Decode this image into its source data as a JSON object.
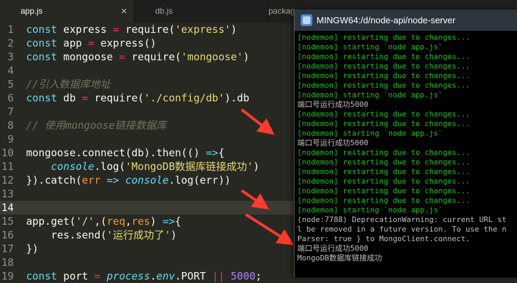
{
  "editor": {
    "tabs": [
      {
        "label": "app.js",
        "close_icon": "×"
      },
      {
        "label": "db.js"
      },
      {
        "label": "package"
      }
    ],
    "lines": [
      {
        "n": "1",
        "tokens": [
          [
            "kw",
            "const"
          ],
          [
            "t",
            " express "
          ],
          [
            "op",
            "="
          ],
          [
            "t",
            " require("
          ],
          [
            "str",
            "'express'"
          ],
          [
            "t",
            ")"
          ]
        ]
      },
      {
        "n": "2",
        "tokens": [
          [
            "kw",
            "const"
          ],
          [
            "t",
            " app "
          ],
          [
            "op",
            "="
          ],
          [
            "t",
            " express()"
          ]
        ]
      },
      {
        "n": "3",
        "tokens": [
          [
            "kw",
            "const"
          ],
          [
            "t",
            " mongoose "
          ],
          [
            "op",
            "="
          ],
          [
            "t",
            " require("
          ],
          [
            "str",
            "'mongoose'"
          ],
          [
            "t",
            ")"
          ]
        ]
      },
      {
        "n": "4",
        "tokens": []
      },
      {
        "n": "5",
        "tokens": [
          [
            "cm",
            "//引入数据库地址"
          ]
        ]
      },
      {
        "n": "6",
        "tokens": [
          [
            "kw",
            "const"
          ],
          [
            "t",
            " db "
          ],
          [
            "op",
            "="
          ],
          [
            "t",
            " require("
          ],
          [
            "str",
            "'./config/db'"
          ],
          [
            "t",
            ").db"
          ]
        ]
      },
      {
        "n": "7",
        "tokens": []
      },
      {
        "n": "8",
        "tokens": [
          [
            "cm",
            "// 使用mongoose链接数据库"
          ]
        ]
      },
      {
        "n": "9",
        "tokens": []
      },
      {
        "n": "10",
        "tokens": [
          [
            "t",
            "mongoose.connect(db).then(() "
          ],
          [
            "kw",
            "=>"
          ],
          [
            "t",
            "{"
          ]
        ]
      },
      {
        "n": "11",
        "tokens": [
          [
            "t",
            "    "
          ],
          [
            "it",
            "console"
          ],
          [
            "t",
            ".log("
          ],
          [
            "str",
            "'MongoDB数据库链接成功'"
          ],
          [
            "t",
            ")"
          ]
        ]
      },
      {
        "n": "12",
        "tokens": [
          [
            "t",
            "}).catch("
          ],
          [
            "param",
            "err"
          ],
          [
            "t",
            " "
          ],
          [
            "kw",
            "=>"
          ],
          [
            "t",
            " "
          ],
          [
            "it",
            "console"
          ],
          [
            "t",
            ".log(err))"
          ]
        ]
      },
      {
        "n": "13",
        "tokens": []
      },
      {
        "n": "14",
        "tokens": [],
        "highlight": true
      },
      {
        "n": "15",
        "tokens": [
          [
            "t",
            "app.get("
          ],
          [
            "str",
            "'/'"
          ],
          [
            "t",
            ",("
          ],
          [
            "param",
            "req"
          ],
          [
            "t",
            ","
          ],
          [
            "param",
            "res"
          ],
          [
            "t",
            ") "
          ],
          [
            "kw",
            "=>"
          ],
          [
            "t",
            "{"
          ]
        ]
      },
      {
        "n": "16",
        "tokens": [
          [
            "t",
            "    res.send("
          ],
          [
            "str",
            "'运行成功了'"
          ],
          [
            "t",
            ")"
          ]
        ]
      },
      {
        "n": "17",
        "tokens": [
          [
            "t",
            "})"
          ]
        ]
      },
      {
        "n": "18",
        "tokens": []
      },
      {
        "n": "19",
        "tokens": [
          [
            "kw",
            "const"
          ],
          [
            "t",
            " port "
          ],
          [
            "op",
            "="
          ],
          [
            "t",
            " "
          ],
          [
            "it",
            "process"
          ],
          [
            "t",
            "."
          ],
          [
            "it",
            "env"
          ],
          [
            "t",
            ".PORT "
          ],
          [
            "op",
            "||"
          ],
          [
            "t",
            " "
          ],
          [
            "num",
            "5000"
          ],
          [
            "t",
            ";"
          ]
        ]
      }
    ]
  },
  "terminal": {
    "title": "MINGW64:/d/node-api/node-server",
    "lines": [
      {
        "text": "[nodemon] restarting due to changes...",
        "color": "green"
      },
      {
        "text": "[nodemon] starting `node app.js`",
        "color": "green"
      },
      {
        "text": "[nodemon] restarting due to changes...",
        "color": "green"
      },
      {
        "text": "[nodemon] restarting due to changes...",
        "color": "green"
      },
      {
        "text": "[nodemon] restarting due to changes...",
        "color": "green"
      },
      {
        "text": "[nodemon] restarting due to changes...",
        "color": "green"
      },
      {
        "text": "[nodemon] starting `node app.js`",
        "color": "green"
      },
      {
        "text": "端口号运行成功5000",
        "color": "white"
      },
      {
        "text": "[nodemon] restarting due to changes...",
        "color": "green"
      },
      {
        "text": "[nodemon] restarting due to changes...",
        "color": "green"
      },
      {
        "text": "[nodemon] starting `node app.js`",
        "color": "green"
      },
      {
        "text": "端口号运行成功5000",
        "color": "white"
      },
      {
        "text": "[nodemon] restarting due to changes...",
        "color": "green"
      },
      {
        "text": "[nodemon] restarting due to changes...",
        "color": "green"
      },
      {
        "text": "[nodemon] restarting due to changes...",
        "color": "green"
      },
      {
        "text": "[nodemon] restarting due to changes...",
        "color": "green"
      },
      {
        "text": "[nodemon] restarting due to changes...",
        "color": "green"
      },
      {
        "text": "[nodemon] restarting due to changes...",
        "color": "green"
      },
      {
        "text": "[nodemon] starting `node app.js`",
        "color": "green"
      },
      {
        "text": "(node:7788) DeprecationWarning: current URL st",
        "color": "white"
      },
      {
        "text": "l be removed in a future version. To use the n",
        "color": "white"
      },
      {
        "text": "Parser: true } to MongoClient.connect.",
        "color": "white"
      },
      {
        "text": "端口号运行成功5000",
        "color": "white"
      },
      {
        "text": "MongoDB数据库链接成功",
        "color": "white"
      }
    ]
  },
  "colors": {
    "editor_bg": "#272822",
    "keyword": "#66d9ef",
    "string": "#e6db74",
    "operator": "#f92672",
    "comment": "#75715e",
    "parameter": "#fd971f",
    "number": "#ae81ff",
    "arrow": "#ff3b30",
    "terminal_green": "#19c519"
  },
  "annotations": {
    "arrow_count": 3,
    "arrow_icon": "red-arrow-icon"
  }
}
